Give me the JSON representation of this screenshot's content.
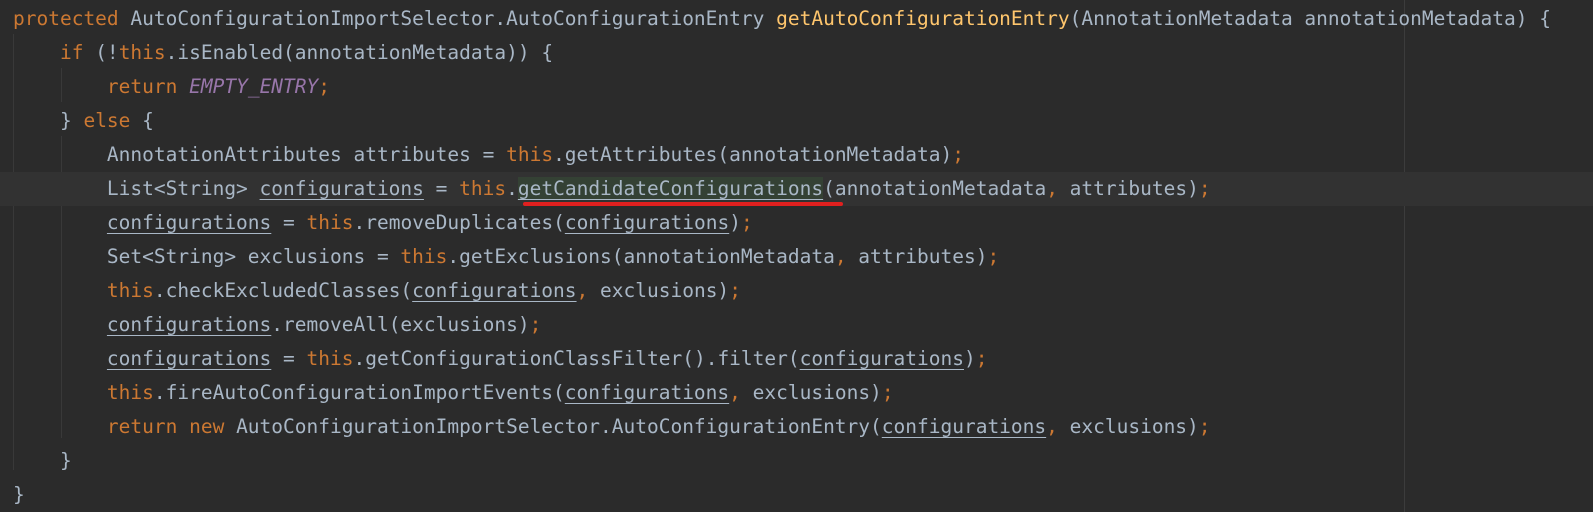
{
  "editor": {
    "colors": {
      "background": "#2b2b2b",
      "keyword": "#cc7832",
      "method_declaration": "#ffc66d",
      "constant": "#9876aa",
      "identifier": "#a9b7c6",
      "current_line": "#323232",
      "usage_highlight": "#344134",
      "annotation_underline": "#e0201f"
    },
    "lines": [
      {
        "tokens": [
          {
            "t": "protected",
            "c": "kw"
          },
          {
            "t": " AutoConfigurationImportSelector.AutoConfigurationEntry ",
            "c": "plain"
          },
          {
            "t": "getAutoConfigurationEntry",
            "c": "fn"
          },
          {
            "t": "(AnnotationMetadata annotationMetadata) {",
            "c": "plain"
          }
        ]
      },
      {
        "tokens": [
          {
            "t": "    ",
            "c": "plain"
          },
          {
            "t": "if",
            "c": "kw"
          },
          {
            "t": " (!",
            "c": "plain"
          },
          {
            "t": "this",
            "c": "kw"
          },
          {
            "t": ".isEnabled(annotationMetadata)) {",
            "c": "plain"
          }
        ]
      },
      {
        "tokens": [
          {
            "t": "        ",
            "c": "plain"
          },
          {
            "t": "return",
            "c": "kw"
          },
          {
            "t": " ",
            "c": "plain"
          },
          {
            "t": "EMPTY_ENTRY",
            "c": "const"
          },
          {
            "t": ";",
            "c": "kw"
          }
        ]
      },
      {
        "tokens": [
          {
            "t": "    } ",
            "c": "plain"
          },
          {
            "t": "else",
            "c": "kw"
          },
          {
            "t": " {",
            "c": "plain"
          }
        ]
      },
      {
        "tokens": [
          {
            "t": "        AnnotationAttributes attributes = ",
            "c": "plain"
          },
          {
            "t": "this",
            "c": "kw"
          },
          {
            "t": ".getAttributes(annotationMetadata)",
            "c": "plain"
          },
          {
            "t": ";",
            "c": "kw"
          }
        ]
      },
      {
        "current": true,
        "tokens": [
          {
            "t": "        List<String> ",
            "c": "plain"
          },
          {
            "t": "configurations",
            "c": "uvar"
          },
          {
            "t": " = ",
            "c": "plain"
          },
          {
            "t": "this",
            "c": "kw"
          },
          {
            "t": ".",
            "c": "plain"
          },
          {
            "t": "getCandidateConfigurations",
            "c": "hl"
          },
          {
            "t": "(annotationMetadata",
            "c": "plain"
          },
          {
            "t": ",",
            "c": "kw"
          },
          {
            "t": " attributes)",
            "c": "plain"
          },
          {
            "t": ";",
            "c": "kw"
          }
        ]
      },
      {
        "tokens": [
          {
            "t": "        ",
            "c": "plain"
          },
          {
            "t": "configurations",
            "c": "uvar"
          },
          {
            "t": " = ",
            "c": "plain"
          },
          {
            "t": "this",
            "c": "kw"
          },
          {
            "t": ".removeDuplicates(",
            "c": "plain"
          },
          {
            "t": "configurations",
            "c": "uvar"
          },
          {
            "t": ")",
            "c": "plain"
          },
          {
            "t": ";",
            "c": "kw"
          }
        ]
      },
      {
        "tokens": [
          {
            "t": "        Set<String> exclusions = ",
            "c": "plain"
          },
          {
            "t": "this",
            "c": "kw"
          },
          {
            "t": ".getExclusions(annotationMetadata",
            "c": "plain"
          },
          {
            "t": ",",
            "c": "kw"
          },
          {
            "t": " attributes)",
            "c": "plain"
          },
          {
            "t": ";",
            "c": "kw"
          }
        ]
      },
      {
        "tokens": [
          {
            "t": "        ",
            "c": "plain"
          },
          {
            "t": "this",
            "c": "kw"
          },
          {
            "t": ".checkExcludedClasses(",
            "c": "plain"
          },
          {
            "t": "configurations",
            "c": "uvar"
          },
          {
            "t": ",",
            "c": "kw"
          },
          {
            "t": " exclusions)",
            "c": "plain"
          },
          {
            "t": ";",
            "c": "kw"
          }
        ]
      },
      {
        "tokens": [
          {
            "t": "        ",
            "c": "plain"
          },
          {
            "t": "configurations",
            "c": "uvar"
          },
          {
            "t": ".removeAll(exclusions)",
            "c": "plain"
          },
          {
            "t": ";",
            "c": "kw"
          }
        ]
      },
      {
        "tokens": [
          {
            "t": "        ",
            "c": "plain"
          },
          {
            "t": "configurations",
            "c": "uvar"
          },
          {
            "t": " = ",
            "c": "plain"
          },
          {
            "t": "this",
            "c": "kw"
          },
          {
            "t": ".getConfigurationClassFilter().filter(",
            "c": "plain"
          },
          {
            "t": "configurations",
            "c": "uvar"
          },
          {
            "t": ")",
            "c": "plain"
          },
          {
            "t": ";",
            "c": "kw"
          }
        ]
      },
      {
        "tokens": [
          {
            "t": "        ",
            "c": "plain"
          },
          {
            "t": "this",
            "c": "kw"
          },
          {
            "t": ".fireAutoConfigurationImportEvents(",
            "c": "plain"
          },
          {
            "t": "configurations",
            "c": "uvar"
          },
          {
            "t": ",",
            "c": "kw"
          },
          {
            "t": " exclusions)",
            "c": "plain"
          },
          {
            "t": ";",
            "c": "kw"
          }
        ]
      },
      {
        "tokens": [
          {
            "t": "        ",
            "c": "plain"
          },
          {
            "t": "return new",
            "c": "kw"
          },
          {
            "t": " AutoConfigurationImportSelector.AutoConfigurationEntry(",
            "c": "plain"
          },
          {
            "t": "configurations",
            "c": "uvar"
          },
          {
            "t": ",",
            "c": "kw"
          },
          {
            "t": " exclusions)",
            "c": "plain"
          },
          {
            "t": ";",
            "c": "kw"
          }
        ]
      },
      {
        "tokens": [
          {
            "t": "    }",
            "c": "plain"
          }
        ]
      },
      {
        "tokens": [
          {
            "t": "}",
            "c": "plain"
          }
        ]
      }
    ]
  }
}
